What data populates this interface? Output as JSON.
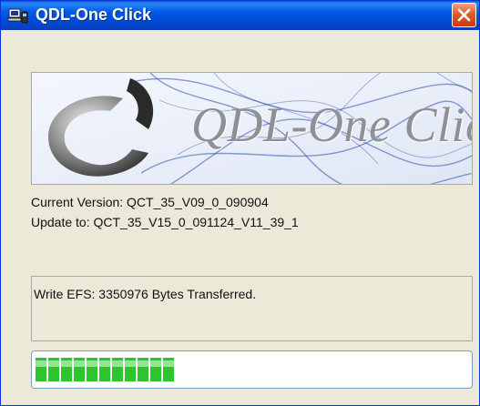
{
  "window": {
    "title": "QDL-One Click"
  },
  "banner": {
    "logo_text": "QDL-One Click"
  },
  "info": {
    "current_version": "Current Version: QCT_35_V09_0_090904",
    "update_to": "Update to: QCT_35_V15_0_091124_V11_39_1"
  },
  "status": {
    "message": "Write EFS: 3350976 Bytes Transferred."
  },
  "progress": {
    "fraction": 0.34,
    "color": "#2cc52c"
  },
  "colors": {
    "titlebar": "#0058e6",
    "close_button": "#e05a28",
    "window_bg": "#ece9d8"
  },
  "icons": {
    "title": "computer-phone-icon",
    "close": "close-x-icon",
    "logo": "swirl-logo-icon"
  }
}
